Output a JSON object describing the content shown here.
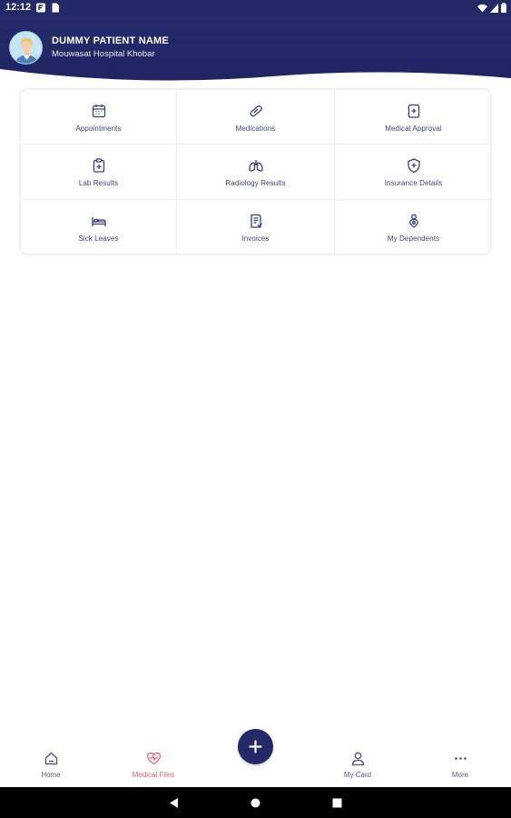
{
  "status_bar": {
    "time": "12:12"
  },
  "header": {
    "patient_name": "DUMMY PATIENT NAME",
    "hospital_name": "Mouwasat Hospital Khobar"
  },
  "menu": {
    "items": [
      {
        "label": "Appointments",
        "icon": "calendar-icon"
      },
      {
        "label": "Medications",
        "icon": "pill-icon"
      },
      {
        "label": "Medical Approval",
        "icon": "medical-approval-icon"
      },
      {
        "label": "Lab Results",
        "icon": "lab-results-icon"
      },
      {
        "label": "Radiology Results",
        "icon": "lungs-icon"
      },
      {
        "label": "Insurance Details",
        "icon": "shield-plus-icon"
      },
      {
        "label": "Sick Leaves",
        "icon": "bed-icon"
      },
      {
        "label": "Invoices",
        "icon": "invoice-icon"
      },
      {
        "label": "My Dependents",
        "icon": "person-pin-icon"
      }
    ]
  },
  "bottom_nav": {
    "home": "Home",
    "medical_files": "Medical Files",
    "my_card": "My Card",
    "more": "More",
    "active": "medical_files"
  },
  "colors": {
    "primary": "#232a67",
    "active_tab": "#e8607a",
    "label_text": "#3b3f78"
  }
}
